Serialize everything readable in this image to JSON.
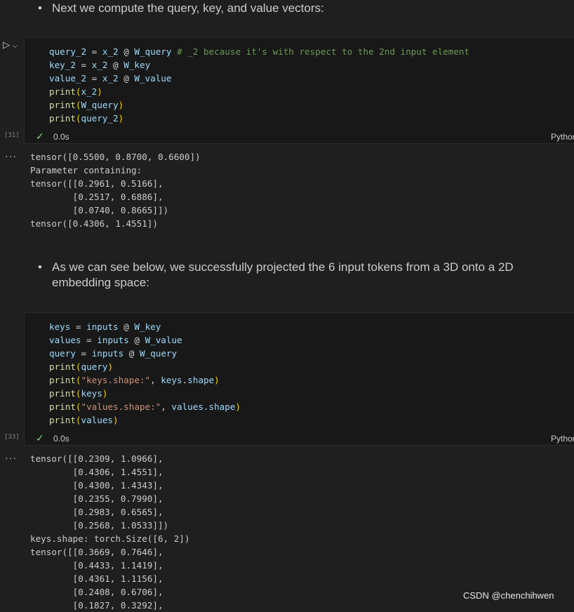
{
  "markdown_1": {
    "bullet": "•",
    "text": "Next we compute the query, key, and value vectors:"
  },
  "cell_1": {
    "exec_count": "[31]",
    "status_time": "0.0s",
    "language": "Python",
    "lines": [
      "query_2 = x_2 @ W_query # _2 because it's with respect to the 2nd input element",
      "key_2 = x_2 @ W_key",
      "value_2 = x_2 @ W_value",
      "print(x_2)",
      "print(W_query)",
      "print(query_2)"
    ]
  },
  "output_1": {
    "lines": [
      "tensor([0.5500, 0.8700, 0.6600])",
      "Parameter containing:",
      "tensor([[0.2961, 0.5166],",
      "        [0.2517, 0.6886],",
      "        [0.0740, 0.8665]])",
      "tensor([0.4306, 1.4551])"
    ]
  },
  "markdown_2": {
    "bullet": "•",
    "text": "As we can see below, we successfully projected the 6 input tokens from a 3D onto a 2D embedding space:"
  },
  "cell_2": {
    "exec_count": "[33]",
    "status_time": "0.0s",
    "language": "Python",
    "lines": [
      "keys = inputs @ W_key",
      "values = inputs @ W_value",
      "query = inputs @ W_query",
      "print(query)",
      "print(\"keys.shape:\", keys.shape)",
      "print(keys)",
      "print(\"values.shape:\", values.shape)",
      "print(values)"
    ]
  },
  "output_2": {
    "lines": [
      "tensor([[0.2309, 1.0966],",
      "        [0.4306, 1.4551],",
      "        [0.4300, 1.4343],",
      "        [0.2355, 0.7990],",
      "        [0.2983, 0.6565],",
      "        [0.2568, 1.0533]])",
      "keys.shape: torch.Size([6, 2])",
      "tensor([[0.3669, 0.7646],",
      "        [0.4433, 1.1419],",
      "        [0.4361, 1.1156],",
      "        [0.2408, 0.6706],",
      "        [0.1827, 0.3292],"
    ]
  },
  "gutter": {
    "run_icon": "▷",
    "chevron": "⌵",
    "output_dots": "···",
    "check": "✓"
  },
  "watermark": "CSDN @chenchihwen"
}
